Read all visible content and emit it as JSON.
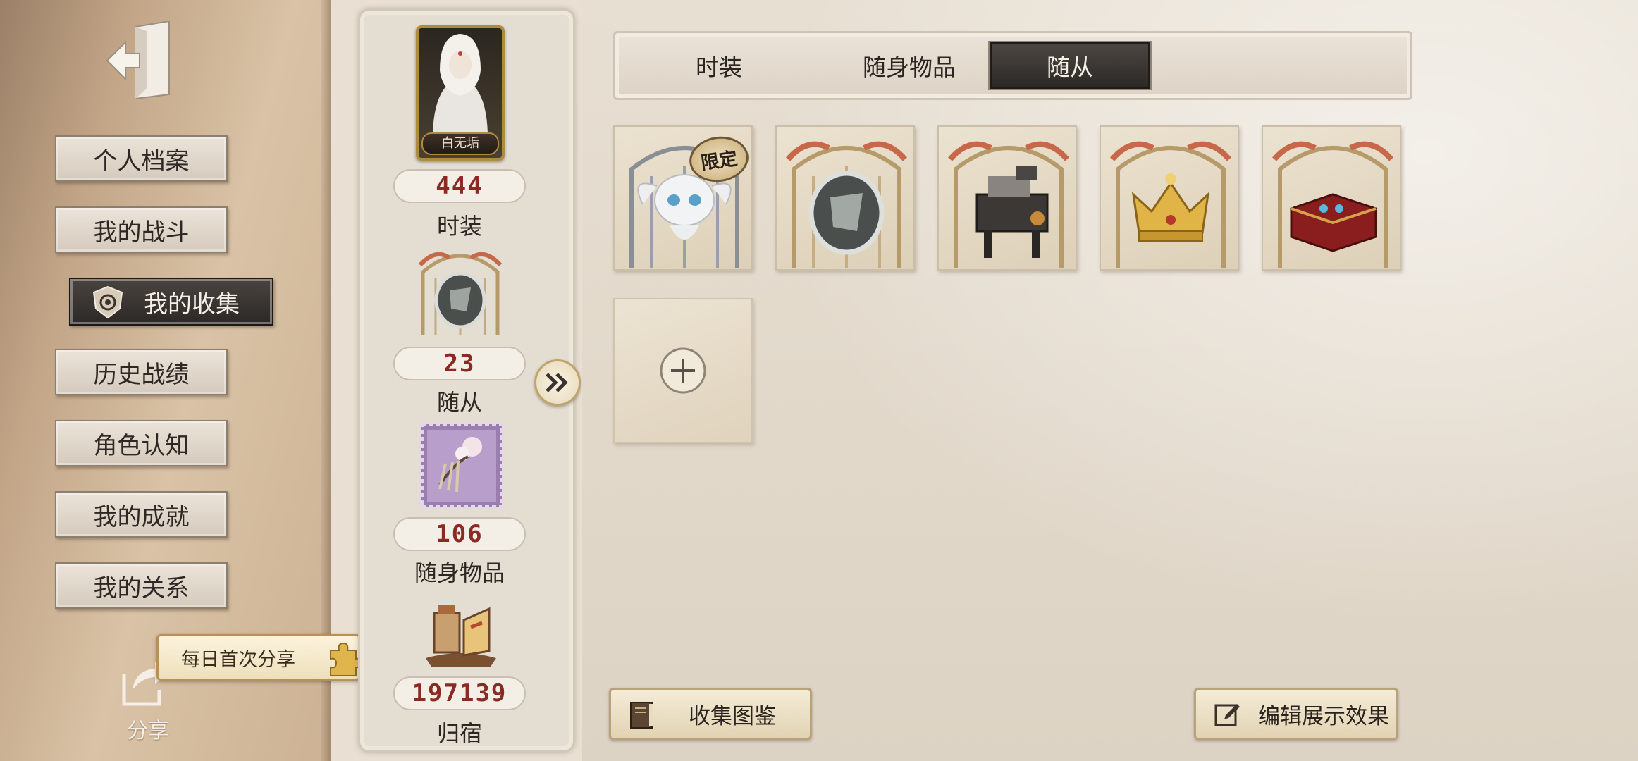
{
  "sidebar": {
    "exit_icon": "exit-door-icon",
    "items": [
      {
        "label": "个人档案"
      },
      {
        "label": "我的战斗"
      },
      {
        "label": "我的收集",
        "active": true,
        "icon": "shield-emblem-icon"
      },
      {
        "label": "历史战绩"
      },
      {
        "label": "角色认知"
      },
      {
        "label": "我的成就"
      },
      {
        "label": "我的关系"
      }
    ],
    "share_tip": "每日首次分享",
    "share_label": "分享"
  },
  "summary": {
    "character_name": "白无垢",
    "stats": [
      {
        "count": "444",
        "label": "时装"
      },
      {
        "count": "23",
        "label": "随从"
      },
      {
        "count": "106",
        "label": "随身物品"
      },
      {
        "count": "197139",
        "label": "归宿"
      }
    ]
  },
  "tabs": [
    {
      "label": "时装"
    },
    {
      "label": "随身物品"
    },
    {
      "label": "随从",
      "active": true
    }
  ],
  "collection": {
    "limited_badge": "限定",
    "items": [
      {
        "icon": "white-winged-cat-pet-icon",
        "limited": true
      },
      {
        "icon": "silver-mirror-pet-icon"
      },
      {
        "icon": "mechanical-robot-pet-icon"
      },
      {
        "icon": "golden-crown-pet-icon"
      },
      {
        "icon": "red-music-box-pet-icon"
      }
    ],
    "add_icon": "plus-icon"
  },
  "footer": {
    "codex_button": "收集图鉴",
    "edit_button": "编辑展示效果"
  },
  "colors": {
    "count_red": "#8b2a22",
    "active_dark": "#2d2926",
    "gold_frame": "#b08a3e"
  }
}
